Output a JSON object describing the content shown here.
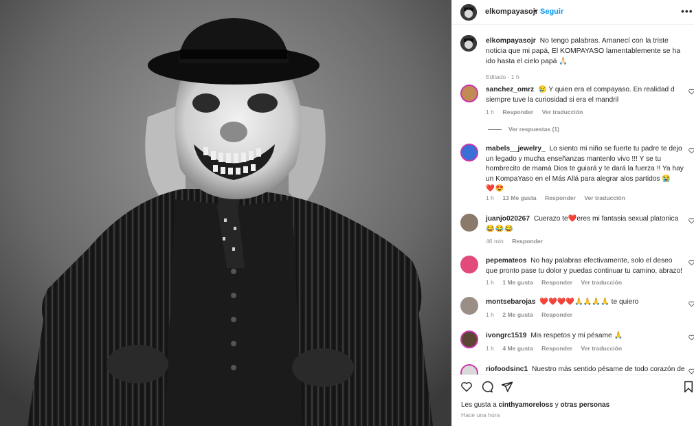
{
  "post": {
    "username": "elkompayasojr",
    "dot": "•",
    "follow_label": "Seguir",
    "more_label": "•••",
    "caption": "No tengo palabras. Amanecí con la triste noticia que mi papá, El KOMPAYASO lamentablemente se ha ido hasta el cielo papá 🙏🏻",
    "edited_label": "Editado · 1 h"
  },
  "comments": [
    {
      "username": "sanchez_omrz",
      "text": "😢 Y quien era el compayaso. En realidad d siempre tuve la curiosidad si era el mandril",
      "time": "1 h",
      "likes": "",
      "reply_label": "Responder",
      "translate_label": "Ver traducción",
      "avatar_color": "#c28a55",
      "ring_color": "#c837ab"
    },
    {
      "username": "mabels__jewelry_",
      "text": "Lo siento mi niño se fuerte tu padre te dejo un legado y mucha enseñanzas mantenlo vivo !!! Y se tu hombrecito de mamá Dios te guiará y te dará la fuerza !! Ya hay un KompaYaso en el Más Allá para alegrar alos partidos 😭",
      "emoji_line": "❤️😍",
      "time": "1 h",
      "likes": "13 Me gusta",
      "reply_label": "Responder",
      "translate_label": "Ver traducción",
      "avatar_color": "#3a6fd8",
      "ring_color": "#c837ab"
    },
    {
      "username": "juanjo020267",
      "text": "Cuerazo te❤️eres mi fantasia sexual platonica",
      "emoji_line": "😂😂😂",
      "time": "46 min",
      "likes": "",
      "reply_label": "Responder",
      "translate_label": "",
      "avatar_color": "#8a7a6a",
      "ring_color": ""
    },
    {
      "username": "pepemateos",
      "text": "No hay palabras efectivamente, solo el deseo que pronto pase tu dolor y puedas continuar tu camino, abrazo!",
      "time": "1 h",
      "likes": "1 Me gusta",
      "reply_label": "Responder",
      "translate_label": "Ver traducción",
      "avatar_color": "#e24a7a",
      "ring_color": ""
    },
    {
      "username": "montsebarojas",
      "text": "❤️❤️❤️❤️🙏🙏🙏🙏 te quiero",
      "time": "1 h",
      "likes": "2 Me gusta",
      "reply_label": "Responder",
      "translate_label": "",
      "avatar_color": "#9b8e86",
      "ring_color": ""
    },
    {
      "username": "ivongrc1519",
      "text": "Mis respetos y mi pésame 🙏",
      "time": "1 h",
      "likes": "4 Me gusta",
      "reply_label": "Responder",
      "translate_label": "Ver traducción",
      "avatar_color": "#5a4632",
      "ring_color": "#c837ab"
    },
    {
      "username": "riofoodsinc1",
      "text": "Nuestro más sentido pésame de todo corazón de",
      "time": "",
      "likes": "",
      "reply_label": "",
      "translate_label": "",
      "avatar_color": "#d9d9d9",
      "ring_color": "#c837ab"
    }
  ],
  "replies_label": "Ver respuestas (1)",
  "footer": {
    "likes_prefix": "Les gusta a",
    "likes_user": "cinthyamoreloss",
    "likes_and": "y",
    "likes_others": "otras personas",
    "posted_label": "Hace una hora"
  },
  "icons": {
    "like": "heart-icon",
    "comment": "comment-icon",
    "share": "share-icon",
    "save": "bookmark-icon",
    "more": "more-icon"
  },
  "colors": {
    "accent": "#0095f6",
    "text": "#262626",
    "muted": "#8e8e8e",
    "divider": "#efefef"
  }
}
